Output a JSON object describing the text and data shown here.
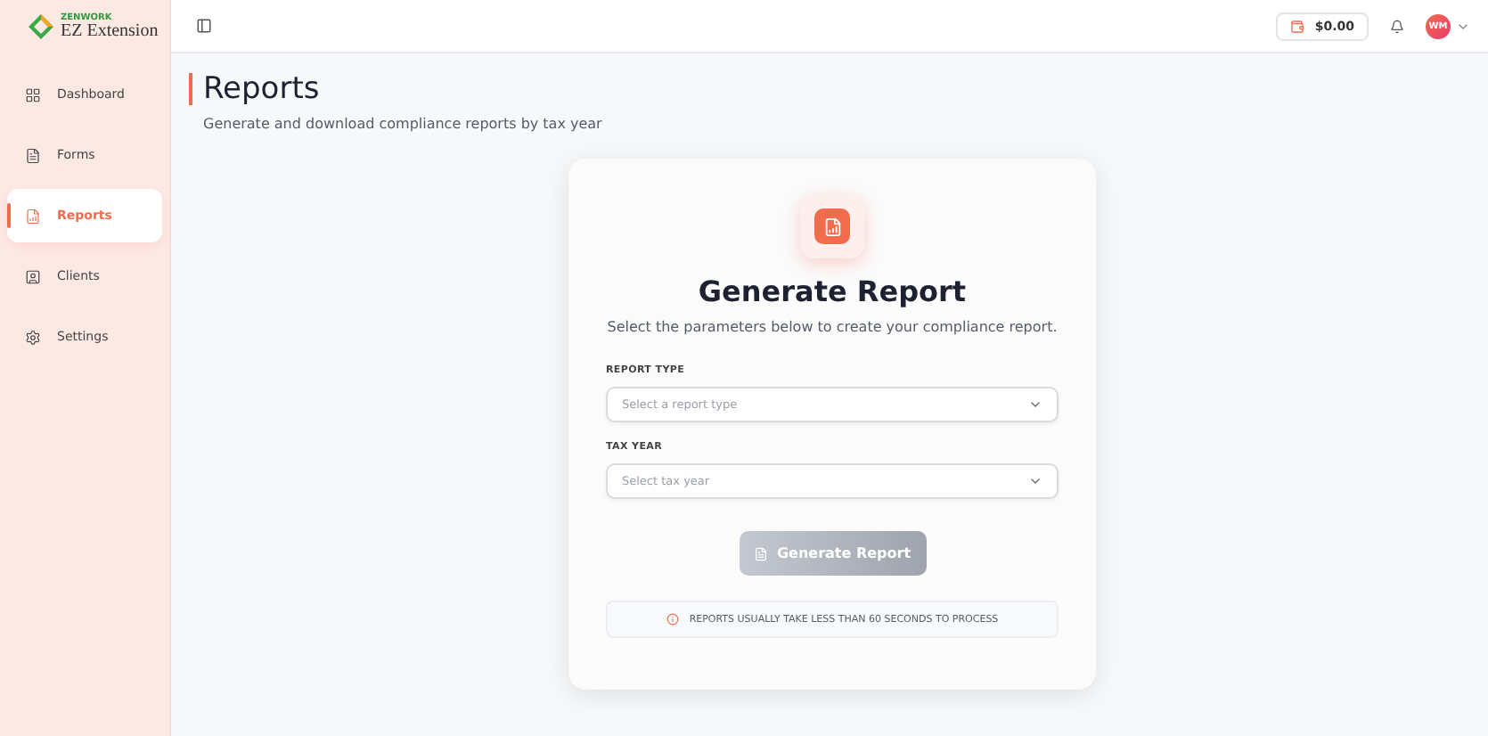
{
  "sidebar": {
    "brand": {
      "top": "ZENWORK",
      "name": "EZ Extension"
    },
    "items": [
      {
        "label": "Dashboard",
        "selected": false
      },
      {
        "label": "Forms",
        "selected": false
      },
      {
        "label": "Reports",
        "selected": true
      },
      {
        "label": "Clients",
        "selected": false
      },
      {
        "label": "Settings",
        "selected": false
      }
    ]
  },
  "header": {
    "balance": "$0.00",
    "avatar": "WM"
  },
  "page": {
    "title": "Reports",
    "subtitle": "Generate and download compliance reports by tax year"
  },
  "card": {
    "title": "Generate Report",
    "subtitle": "Select the parameters below to create your compliance report.",
    "fields": [
      {
        "label": "REPORT TYPE",
        "placeholder": "Select a report type"
      },
      {
        "label": "TAX YEAR",
        "placeholder": "Select tax year"
      }
    ],
    "button": {
      "label": "Generate Report",
      "disabled": true
    },
    "note": "REPORTS USUALLY TAKE LESS THAN 60 SECONDS TO PROCESS"
  }
}
